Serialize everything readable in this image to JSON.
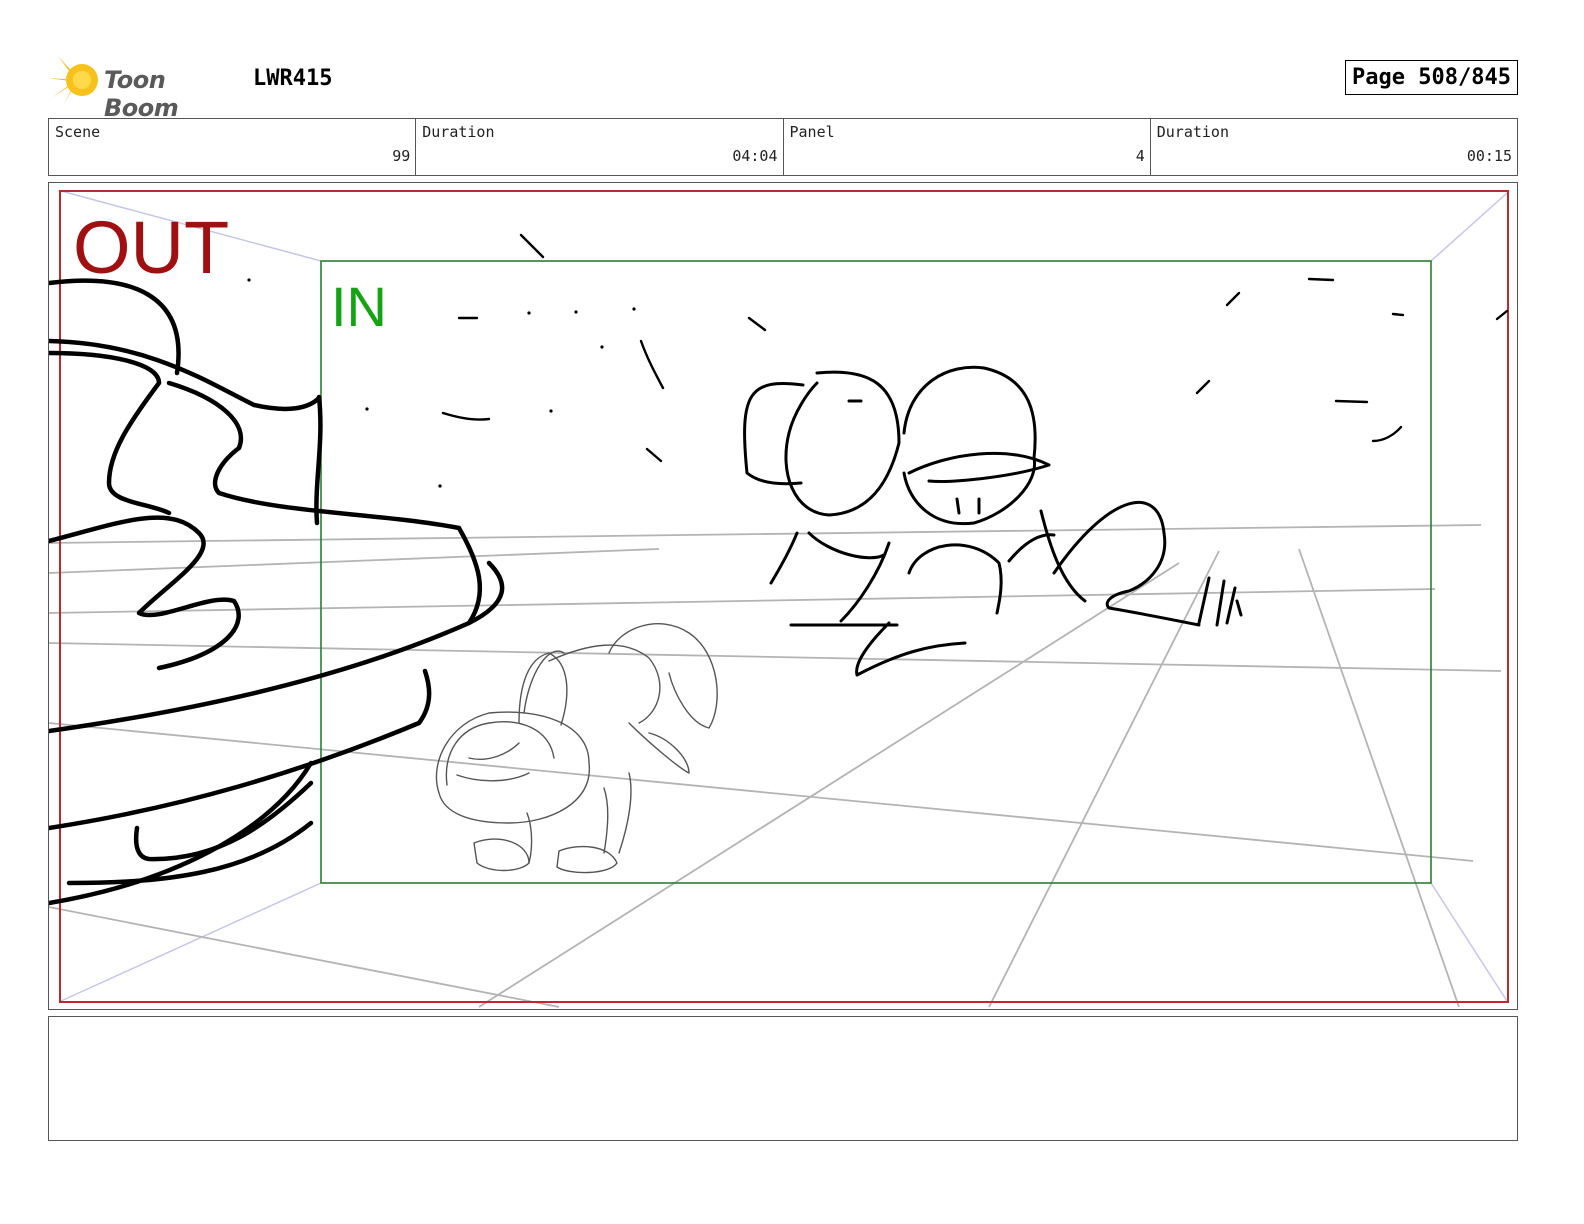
{
  "header": {
    "logo_text": "Toon Boom",
    "project": "LWR415",
    "page": "Page 508/845"
  },
  "info": [
    {
      "label": "Scene",
      "value": "99"
    },
    {
      "label": "Duration",
      "value": "04:04"
    },
    {
      "label": "Panel",
      "value": "4"
    },
    {
      "label": "Duration",
      "value": "00:15"
    }
  ],
  "panel": {
    "out_label": "OUT",
    "in_label": "IN",
    "out_frame_color": "#c0282d",
    "in_frame_color": "#2e7d32"
  },
  "notes": {
    "text": ""
  }
}
